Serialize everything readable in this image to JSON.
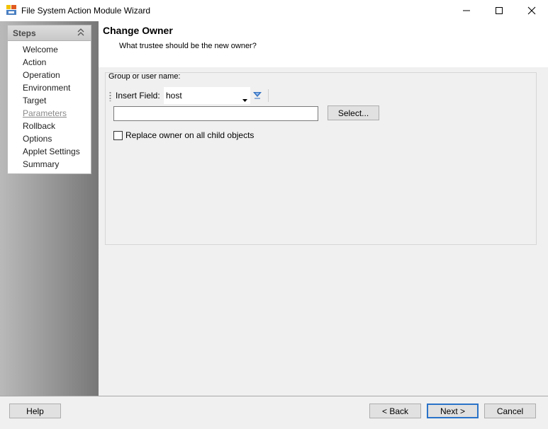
{
  "window": {
    "title": "File System Action Module Wizard",
    "icon": "wizard-app-icon",
    "controls": [
      "minimize-icon",
      "maximize-icon",
      "close-icon"
    ]
  },
  "steps": {
    "header": "Steps",
    "items": [
      {
        "label": "Welcome",
        "state": "normal"
      },
      {
        "label": "Action",
        "state": "normal"
      },
      {
        "label": "Operation",
        "state": "normal"
      },
      {
        "label": "Environment",
        "state": "normal"
      },
      {
        "label": "Target",
        "state": "normal"
      },
      {
        "label": "Parameters",
        "state": "current"
      },
      {
        "label": "Rollback",
        "state": "normal"
      },
      {
        "label": "Options",
        "state": "normal"
      },
      {
        "label": "Applet Settings",
        "state": "normal"
      },
      {
        "label": "Summary",
        "state": "normal"
      }
    ]
  },
  "page": {
    "title": "Change Owner",
    "subtitle": "What trustee should be the new owner?"
  },
  "group": {
    "label": "Group or user name:",
    "insert_field_label": "Insert Field:",
    "insert_field_value": "host",
    "name_value": "",
    "select_label": "Select...",
    "replace_label": "Replace owner on all child objects",
    "replace_checked": false
  },
  "footer": {
    "help": "Help",
    "back": "< Back",
    "next": "Next >",
    "cancel": "Cancel"
  },
  "colors": {
    "accent_border": "#2a73c8",
    "insert_icon": "#2f6fc0"
  }
}
